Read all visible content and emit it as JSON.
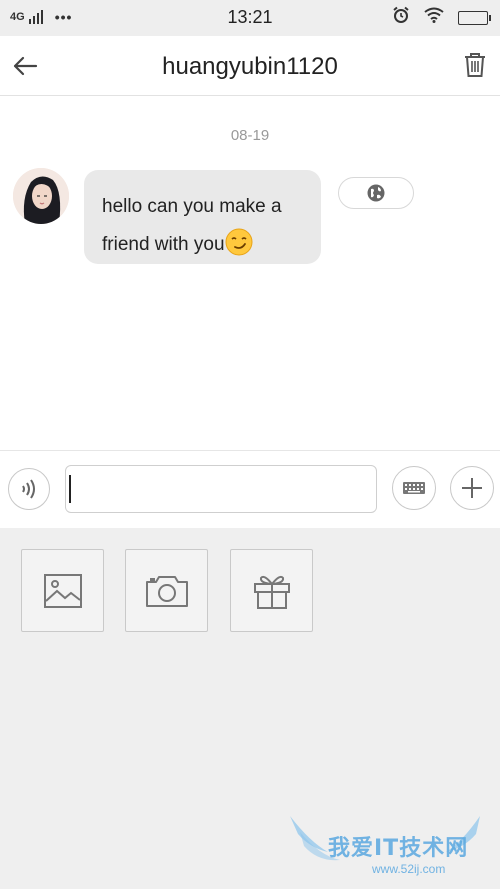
{
  "status_bar": {
    "network": "4G",
    "dots": "•••",
    "time": "13:21"
  },
  "header": {
    "title": "huangyubin1120",
    "back_icon": "arrow-left-icon",
    "delete_icon": "trash-icon"
  },
  "conversation": {
    "date": "08-19",
    "messages": [
      {
        "text": "hello can you make a friend with you",
        "emoji": "smirk-face-emoji",
        "action_icon": "globe-icon"
      }
    ]
  },
  "composer": {
    "voice_icon": "voice-wave-icon",
    "input_value": "",
    "keyboard_icon": "keyboard-icon",
    "plus_icon": "plus-icon"
  },
  "tools": [
    {
      "icon": "image-icon"
    },
    {
      "icon": "camera-icon"
    },
    {
      "icon": "gift-icon"
    }
  ],
  "watermark": {
    "text": "我爱IT技术网",
    "url": "www.52ij.com"
  },
  "colors": {
    "status_bar_bg": "#eeeeee",
    "bubble_bg": "#e9e9e9",
    "panel_bg": "#efefef",
    "watermark": "#5aa8e0"
  }
}
